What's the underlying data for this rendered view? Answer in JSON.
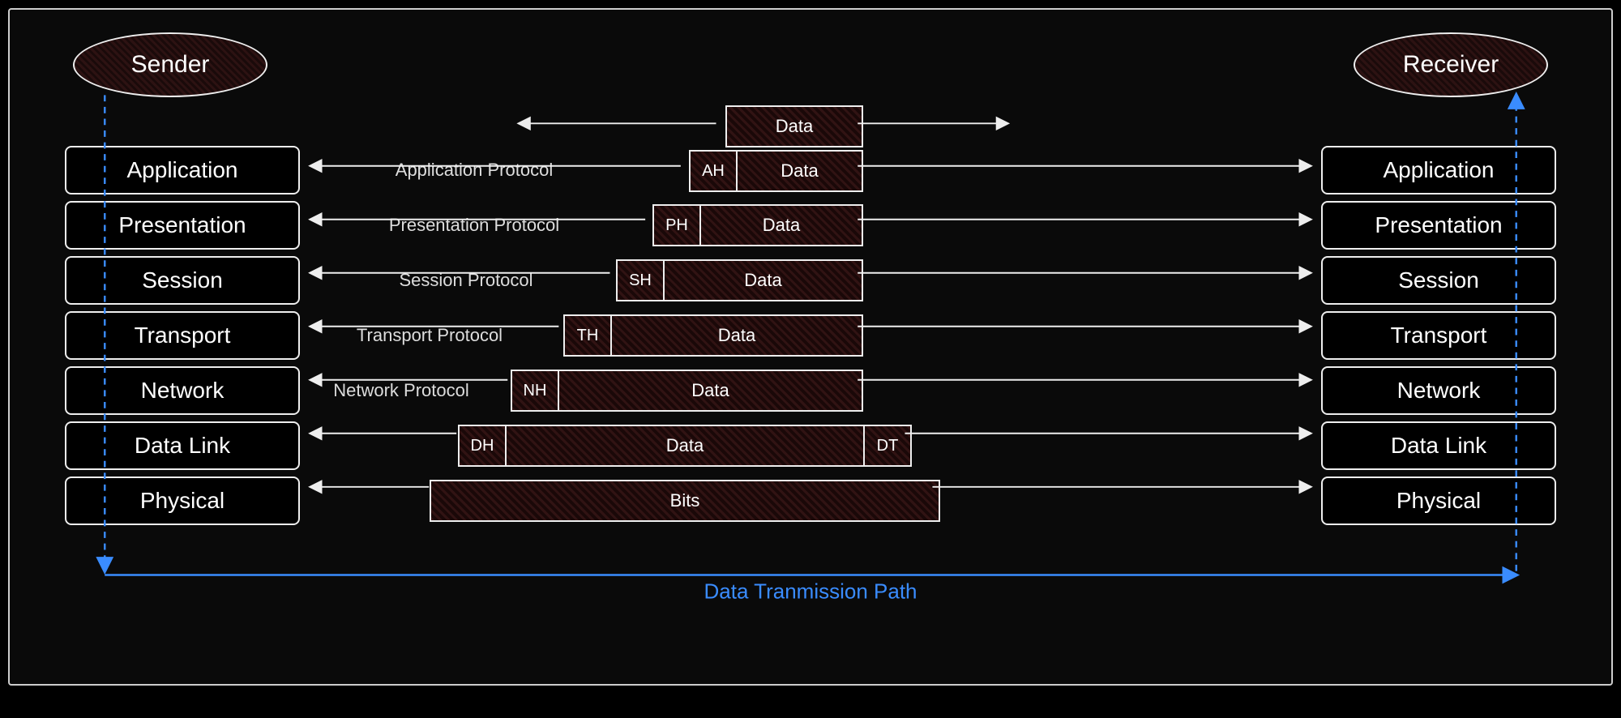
{
  "endpoints": {
    "sender": "Sender",
    "receiver": "Receiver"
  },
  "layers": [
    {
      "name": "Application",
      "protocol": "Application Protocol"
    },
    {
      "name": "Presentation",
      "protocol": "Presentation Protocol"
    },
    {
      "name": "Session",
      "protocol": "Session Protocol"
    },
    {
      "name": "Transport",
      "protocol": "Transport Protocol"
    },
    {
      "name": "Network",
      "protocol": "Network Protocol"
    },
    {
      "name": "Data Link",
      "protocol": ""
    },
    {
      "name": "Physical",
      "protocol": ""
    }
  ],
  "encapsulation": [
    {
      "header": "",
      "payload": "Data",
      "trailer": ""
    },
    {
      "header": "AH",
      "payload": "Data",
      "trailer": ""
    },
    {
      "header": "PH",
      "payload": "Data",
      "trailer": ""
    },
    {
      "header": "SH",
      "payload": "Data",
      "trailer": ""
    },
    {
      "header": "TH",
      "payload": "Data",
      "trailer": ""
    },
    {
      "header": "NH",
      "payload": "Data",
      "trailer": ""
    },
    {
      "header": "DH",
      "payload": "Data",
      "trailer": "DT"
    },
    {
      "header": "",
      "payload": "Bits",
      "trailer": ""
    }
  ],
  "transmission_path_label": "Data Tranmission Path",
  "colors": {
    "stroke": "#eeeeee",
    "path": "#3a8cff",
    "hatch": "rgba(180,80,80,0.15)"
  }
}
